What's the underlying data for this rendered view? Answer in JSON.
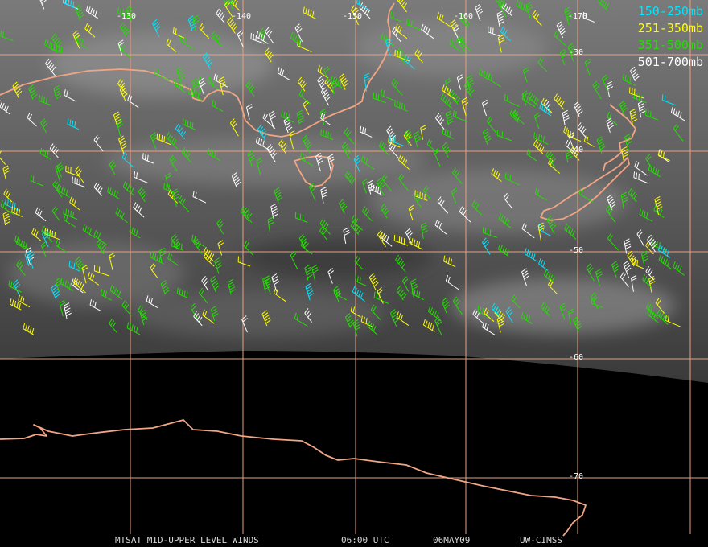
{
  "legend": {
    "items": [
      {
        "label": "150-250mb",
        "color": "#00e5ff"
      },
      {
        "label": "251-350mb",
        "color": "#ffff00"
      },
      {
        "label": "351-500mb",
        "color": "#22dd00"
      },
      {
        "label": "501-700mb",
        "color": "#ffffff"
      }
    ]
  },
  "longitude_labels": [
    "-130",
    "-140",
    "-150",
    "-160",
    "-170"
  ],
  "latitude_labels": [
    "-30",
    "-40",
    "-50",
    "-60",
    "-70"
  ],
  "footer": {
    "product": "MTSAT MID-UPPER LEVEL WINDS",
    "time": "06:00 UTC",
    "date": "06MAY09",
    "source": "UW-CIMSS"
  },
  "colors": {
    "grid": "#e8a080",
    "coast": "#f2a585",
    "background": "#000000"
  }
}
